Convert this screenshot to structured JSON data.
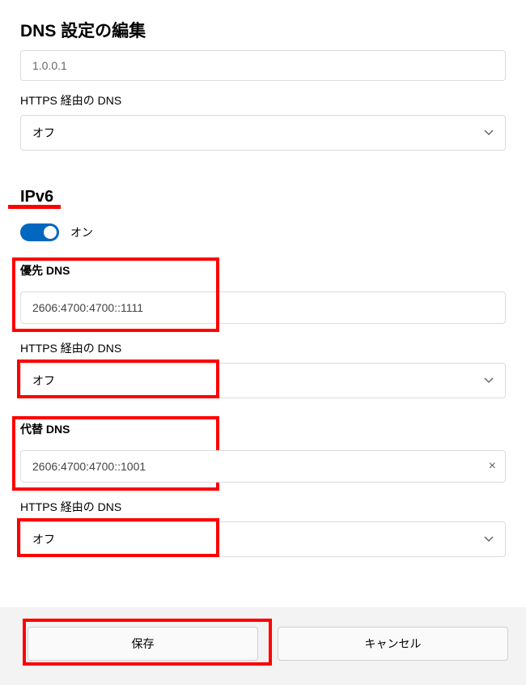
{
  "title": "DNS 設定の編集",
  "ipv4": {
    "truncated_value": "1.0.0.1",
    "https_dns_label": "HTTPS 経由の DNS",
    "https_dns_value": "オフ"
  },
  "ipv6": {
    "heading": "IPv6",
    "toggle_label": "オン",
    "primary_dns_label": "優先 DNS",
    "primary_dns_value": "2606:4700:4700::1111",
    "primary_https_label": "HTTPS 経由の DNS",
    "primary_https_value": "オフ",
    "alt_dns_label": "代替 DNS",
    "alt_dns_value": "2606:4700:4700::1001",
    "alt_https_label": "HTTPS 経由の DNS",
    "alt_https_value": "オフ"
  },
  "footer": {
    "save": "保存",
    "cancel": "キャンセル"
  }
}
